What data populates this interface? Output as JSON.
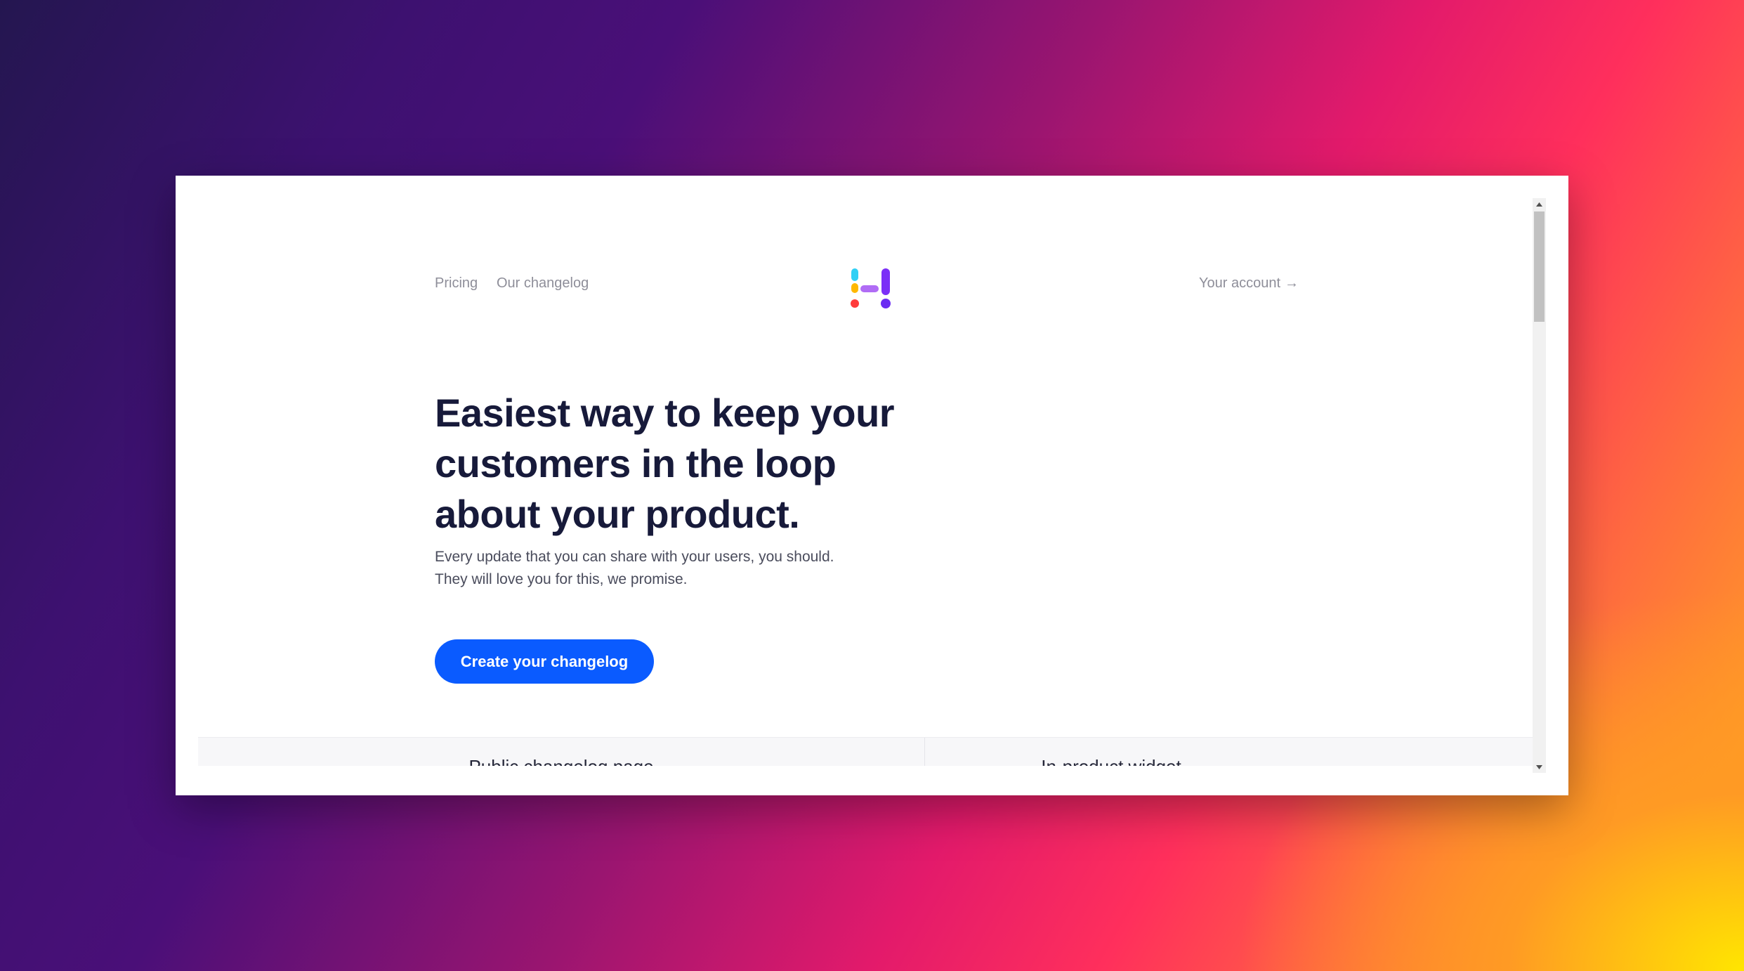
{
  "nav": {
    "pricing": "Pricing",
    "changelog": "Our changelog",
    "account": "Your account",
    "account_arrow": "→"
  },
  "logo": {
    "icon": "headway-logo-icon",
    "colors": [
      "#2fd0f5",
      "#ffb800",
      "#ff3b3b",
      "#b06cf5",
      "#6b2cf2",
      "#7b2ff7"
    ]
  },
  "hero": {
    "title_line_1": "Easiest way to keep your",
    "title_line_2": "customers in the loop",
    "title_line_3": "about your product.",
    "subtitle_line_1": "Every update that you can share with your users, you should.",
    "subtitle_line_2": "They will love you for this, we promise.",
    "cta_label": "Create your changelog"
  },
  "features": {
    "public_page": "Public changelog page",
    "widget": "In-product widget"
  },
  "colors": {
    "accent": "#0a5bff",
    "heading": "#171a3a",
    "nav_text": "#8e8e99"
  }
}
